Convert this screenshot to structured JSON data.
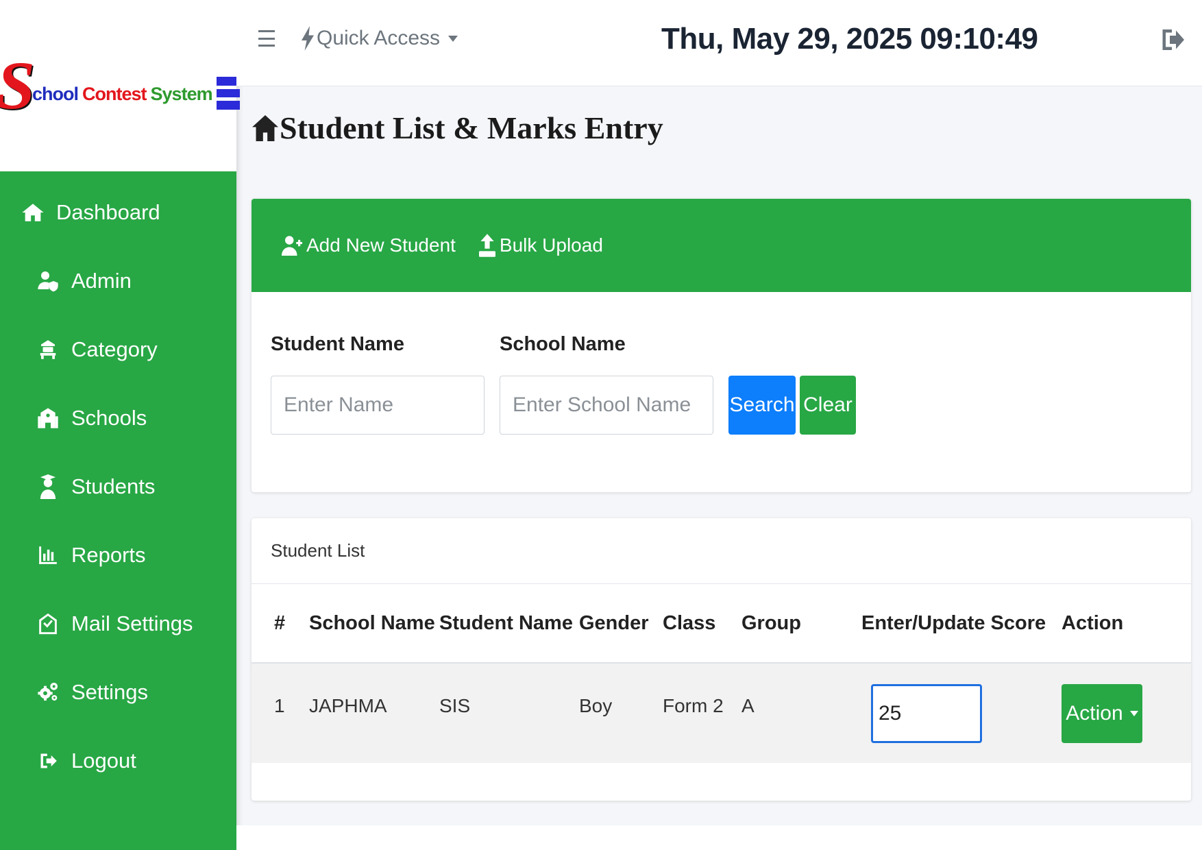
{
  "brand": {
    "logo_letter": "S",
    "logo_words": [
      "chool",
      "Contest",
      "System"
    ]
  },
  "colors": {
    "primary_green": "#28a745",
    "search_blue": "#0d7efc",
    "logo_red": "#e3161d",
    "logo_blue": "#1f2dbd",
    "logo_green": "#2e9a2e"
  },
  "sidebar": {
    "items": [
      {
        "label": "Dashboard",
        "icon": "home-icon"
      },
      {
        "label": "Admin",
        "icon": "user-shield-icon"
      },
      {
        "label": "Category",
        "icon": "category-icon"
      },
      {
        "label": "Schools",
        "icon": "school-icon"
      },
      {
        "label": "Students",
        "icon": "student-icon"
      },
      {
        "label": "Reports",
        "icon": "chart-icon"
      },
      {
        "label": "Mail Settings",
        "icon": "mail-icon"
      },
      {
        "label": "Settings",
        "icon": "gears-icon"
      },
      {
        "label": "Logout",
        "icon": "logout-icon"
      }
    ]
  },
  "topbar": {
    "quick_access": "Quick Access",
    "datetime": "Thu, May 29, 2025 09:10:49"
  },
  "page": {
    "title": "Student List & Marks Entry"
  },
  "actions": {
    "add_student": "Add New Student",
    "bulk_upload": "Bulk Upload"
  },
  "filters": {
    "student_label": "Student Name",
    "student_placeholder": "Enter Name",
    "school_label": "School Name",
    "school_placeholder": "Enter School Name",
    "search_label": "Search",
    "clear_label": "Clear"
  },
  "student_list": {
    "title": "Student List",
    "columns": [
      "#",
      "School Name",
      "Student Name",
      "Gender",
      "Class",
      "Group",
      "Enter/Update Score",
      "Action"
    ],
    "rows": [
      {
        "num": "1",
        "school": "JAPHMA",
        "student": "SIS",
        "gender": "Boy",
        "class": "Form 2",
        "group": "A",
        "score": "25",
        "action_label": "Action"
      }
    ]
  }
}
